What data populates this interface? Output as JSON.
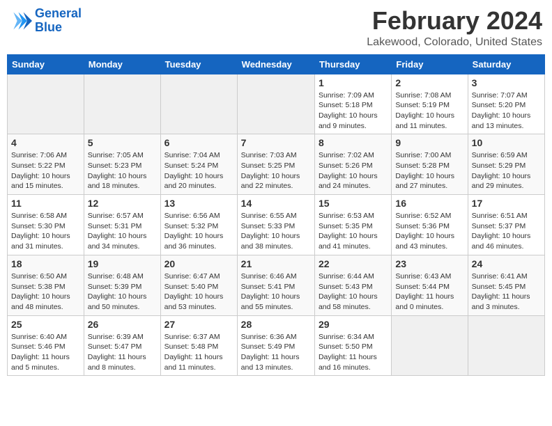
{
  "header": {
    "logo_line1": "General",
    "logo_line2": "Blue",
    "month_year": "February 2024",
    "location": "Lakewood, Colorado, United States"
  },
  "weekdays": [
    "Sunday",
    "Monday",
    "Tuesday",
    "Wednesday",
    "Thursday",
    "Friday",
    "Saturday"
  ],
  "weeks": [
    [
      {
        "day": "",
        "info": ""
      },
      {
        "day": "",
        "info": ""
      },
      {
        "day": "",
        "info": ""
      },
      {
        "day": "",
        "info": ""
      },
      {
        "day": "1",
        "info": "Sunrise: 7:09 AM\nSunset: 5:18 PM\nDaylight: 10 hours\nand 9 minutes."
      },
      {
        "day": "2",
        "info": "Sunrise: 7:08 AM\nSunset: 5:19 PM\nDaylight: 10 hours\nand 11 minutes."
      },
      {
        "day": "3",
        "info": "Sunrise: 7:07 AM\nSunset: 5:20 PM\nDaylight: 10 hours\nand 13 minutes."
      }
    ],
    [
      {
        "day": "4",
        "info": "Sunrise: 7:06 AM\nSunset: 5:22 PM\nDaylight: 10 hours\nand 15 minutes."
      },
      {
        "day": "5",
        "info": "Sunrise: 7:05 AM\nSunset: 5:23 PM\nDaylight: 10 hours\nand 18 minutes."
      },
      {
        "day": "6",
        "info": "Sunrise: 7:04 AM\nSunset: 5:24 PM\nDaylight: 10 hours\nand 20 minutes."
      },
      {
        "day": "7",
        "info": "Sunrise: 7:03 AM\nSunset: 5:25 PM\nDaylight: 10 hours\nand 22 minutes."
      },
      {
        "day": "8",
        "info": "Sunrise: 7:02 AM\nSunset: 5:26 PM\nDaylight: 10 hours\nand 24 minutes."
      },
      {
        "day": "9",
        "info": "Sunrise: 7:00 AM\nSunset: 5:28 PM\nDaylight: 10 hours\nand 27 minutes."
      },
      {
        "day": "10",
        "info": "Sunrise: 6:59 AM\nSunset: 5:29 PM\nDaylight: 10 hours\nand 29 minutes."
      }
    ],
    [
      {
        "day": "11",
        "info": "Sunrise: 6:58 AM\nSunset: 5:30 PM\nDaylight: 10 hours\nand 31 minutes."
      },
      {
        "day": "12",
        "info": "Sunrise: 6:57 AM\nSunset: 5:31 PM\nDaylight: 10 hours\nand 34 minutes."
      },
      {
        "day": "13",
        "info": "Sunrise: 6:56 AM\nSunset: 5:32 PM\nDaylight: 10 hours\nand 36 minutes."
      },
      {
        "day": "14",
        "info": "Sunrise: 6:55 AM\nSunset: 5:33 PM\nDaylight: 10 hours\nand 38 minutes."
      },
      {
        "day": "15",
        "info": "Sunrise: 6:53 AM\nSunset: 5:35 PM\nDaylight: 10 hours\nand 41 minutes."
      },
      {
        "day": "16",
        "info": "Sunrise: 6:52 AM\nSunset: 5:36 PM\nDaylight: 10 hours\nand 43 minutes."
      },
      {
        "day": "17",
        "info": "Sunrise: 6:51 AM\nSunset: 5:37 PM\nDaylight: 10 hours\nand 46 minutes."
      }
    ],
    [
      {
        "day": "18",
        "info": "Sunrise: 6:50 AM\nSunset: 5:38 PM\nDaylight: 10 hours\nand 48 minutes."
      },
      {
        "day": "19",
        "info": "Sunrise: 6:48 AM\nSunset: 5:39 PM\nDaylight: 10 hours\nand 50 minutes."
      },
      {
        "day": "20",
        "info": "Sunrise: 6:47 AM\nSunset: 5:40 PM\nDaylight: 10 hours\nand 53 minutes."
      },
      {
        "day": "21",
        "info": "Sunrise: 6:46 AM\nSunset: 5:41 PM\nDaylight: 10 hours\nand 55 minutes."
      },
      {
        "day": "22",
        "info": "Sunrise: 6:44 AM\nSunset: 5:43 PM\nDaylight: 10 hours\nand 58 minutes."
      },
      {
        "day": "23",
        "info": "Sunrise: 6:43 AM\nSunset: 5:44 PM\nDaylight: 11 hours\nand 0 minutes."
      },
      {
        "day": "24",
        "info": "Sunrise: 6:41 AM\nSunset: 5:45 PM\nDaylight: 11 hours\nand 3 minutes."
      }
    ],
    [
      {
        "day": "25",
        "info": "Sunrise: 6:40 AM\nSunset: 5:46 PM\nDaylight: 11 hours\nand 5 minutes."
      },
      {
        "day": "26",
        "info": "Sunrise: 6:39 AM\nSunset: 5:47 PM\nDaylight: 11 hours\nand 8 minutes."
      },
      {
        "day": "27",
        "info": "Sunrise: 6:37 AM\nSunset: 5:48 PM\nDaylight: 11 hours\nand 11 minutes."
      },
      {
        "day": "28",
        "info": "Sunrise: 6:36 AM\nSunset: 5:49 PM\nDaylight: 11 hours\nand 13 minutes."
      },
      {
        "day": "29",
        "info": "Sunrise: 6:34 AM\nSunset: 5:50 PM\nDaylight: 11 hours\nand 16 minutes."
      },
      {
        "day": "",
        "info": ""
      },
      {
        "day": "",
        "info": ""
      }
    ]
  ]
}
